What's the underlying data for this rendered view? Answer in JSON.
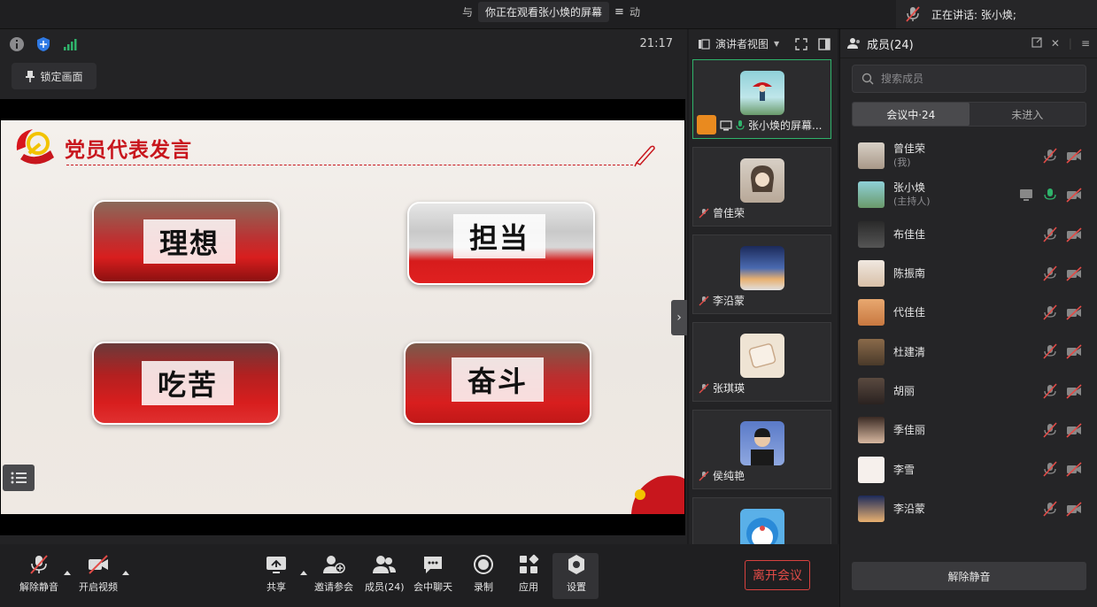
{
  "top": {
    "notice_prefix": "与",
    "notice_text": "你正在观看张小焕的屏幕",
    "notice_suffix": "动",
    "speaking_label": "正在讲话: 张小焕;"
  },
  "stage": {
    "time": "21:17",
    "lock_label": "锁定画面",
    "slide": {
      "title": "党员代表发言",
      "cards": [
        "理想",
        "担当",
        "吃苦",
        "奋斗"
      ]
    }
  },
  "videos": {
    "view_label": "演讲者视图",
    "tiles": [
      {
        "name": "张小焕的屏幕..."
      },
      {
        "name": "曾佳荣"
      },
      {
        "name": "李沿蒙"
      },
      {
        "name": "张琪瑛"
      },
      {
        "name": "侯纯艳"
      }
    ]
  },
  "members": {
    "title": "成员(24)",
    "search_placeholder": "搜索成员",
    "tab_in": "会议中·24",
    "tab_out": "未进入",
    "list": [
      {
        "name": "曾佳荣",
        "role": "(我)"
      },
      {
        "name": "张小焕",
        "role": "(主持人)"
      },
      {
        "name": "布佳佳",
        "role": ""
      },
      {
        "name": "陈振南",
        "role": ""
      },
      {
        "name": "代佳佳",
        "role": ""
      },
      {
        "name": "杜建清",
        "role": ""
      },
      {
        "name": "胡丽",
        "role": ""
      },
      {
        "name": "季佳丽",
        "role": ""
      },
      {
        "name": "李雪",
        "role": ""
      },
      {
        "name": "李沿蒙",
        "role": ""
      }
    ],
    "unmute_all": "解除静音"
  },
  "toolbar": {
    "unmute": "解除静音",
    "start_video": "开启视频",
    "share": "共享",
    "invite": "邀请参会",
    "members": "成员(24)",
    "chat": "会中聊天",
    "record": "录制",
    "apps": "应用",
    "settings": "设置",
    "leave": "离开会议"
  },
  "colors": {
    "accent_green": "#2fb36b",
    "leave_red": "#e24b47",
    "slide_red": "#c8161d"
  }
}
